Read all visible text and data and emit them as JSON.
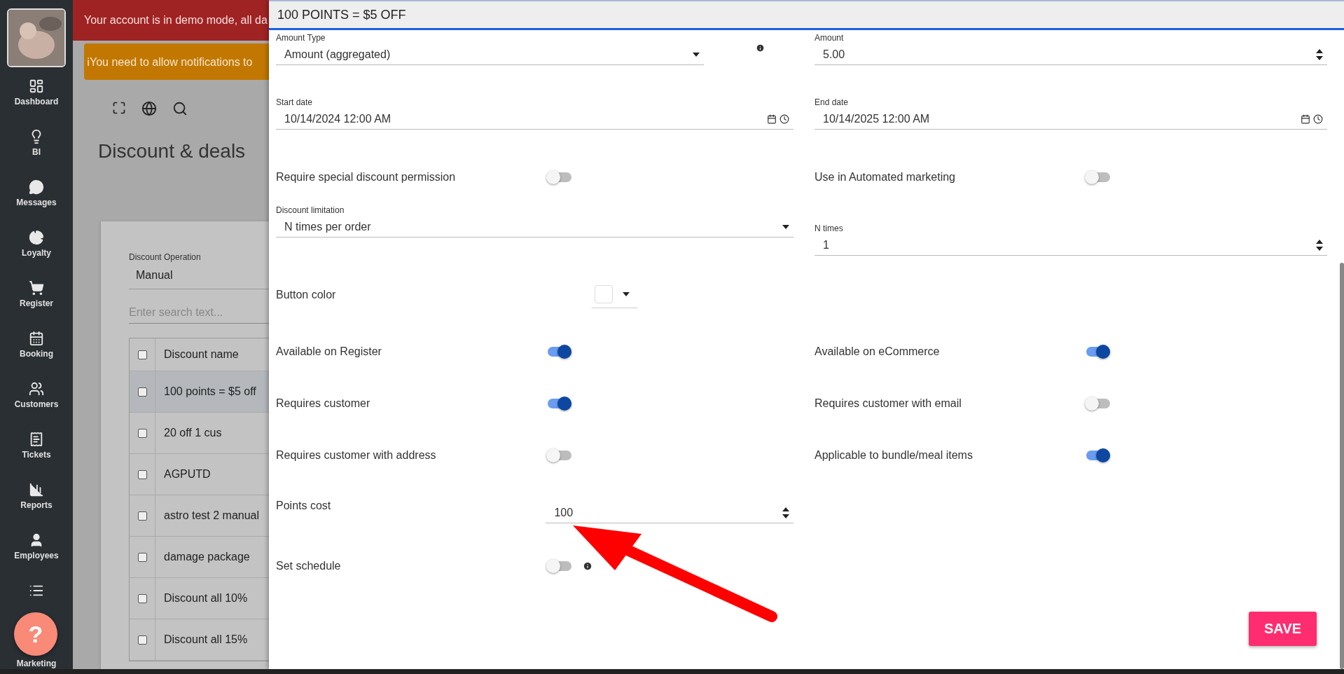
{
  "sidebar": {
    "items": [
      {
        "kind": "labeled",
        "label": "Dashboard"
      },
      {
        "kind": "labeled",
        "label": "BI"
      },
      {
        "kind": "labeled",
        "label": "Messages"
      },
      {
        "kind": "labeled",
        "label": "Loyalty"
      },
      {
        "kind": "labeled",
        "label": "Register"
      },
      {
        "kind": "labeled",
        "label": "Booking"
      },
      {
        "kind": "labeled",
        "label": "Customers"
      },
      {
        "kind": "labeled",
        "label": "Tickets"
      },
      {
        "kind": "labeled",
        "label": "Reports"
      },
      {
        "kind": "labeled",
        "label": "Employees"
      },
      {
        "kind": "icon-only"
      }
    ],
    "help": "?",
    "bottom_label": "Marketing"
  },
  "background": {
    "demo_banner": "Your account is in demo mode, all da",
    "notification_banner": {
      "icon": "ℹ",
      "text": "You need to allow notifications to"
    },
    "title": "Discount & deals",
    "operation": {
      "label": "Discount Operation",
      "value": "Manual"
    },
    "search": {
      "placeholder": "Enter search text..."
    },
    "table": {
      "header": "Discount name",
      "all_checked": false,
      "rows": [
        {
          "name": "100 points = $5 off",
          "selected": true,
          "checked": false
        },
        {
          "name": "20 off 1 cus",
          "selected": false,
          "checked": false
        },
        {
          "name": "AGPUTD",
          "selected": false,
          "checked": false
        },
        {
          "name": "astro test 2 manual",
          "selected": false,
          "checked": false
        },
        {
          "name": "damage package",
          "selected": false,
          "checked": false
        },
        {
          "name": "Discount all 10%",
          "selected": false,
          "checked": false
        },
        {
          "name": "Discount all 15%",
          "selected": false,
          "checked": false
        }
      ]
    }
  },
  "panel": {
    "title": "100 POINTS = $5 OFF",
    "rows": [
      {
        "left": {
          "kind": "select",
          "label": "Amount Type",
          "value": "Amount (aggregated)",
          "info": true
        },
        "right": {
          "kind": "number",
          "label": "Amount",
          "value": "5.00"
        }
      },
      {
        "left": {
          "kind": "date",
          "label": "Start date",
          "value": "10/14/2024 12:00 AM"
        },
        "right": {
          "kind": "date",
          "label": "End date",
          "value": "10/14/2025 12:00 AM"
        }
      },
      {
        "left": {
          "kind": "toggle",
          "label": "Require special discount permission",
          "on": false
        },
        "right": {
          "kind": "toggle",
          "label": "Use in Automated marketing",
          "on": false
        }
      },
      {
        "left": {
          "kind": "select",
          "label": "Discount limitation",
          "value": "N times per order"
        },
        "right": {
          "kind": "number",
          "label": "N times",
          "value": "1"
        }
      },
      {
        "left": {
          "kind": "color",
          "label": "Button color",
          "color": "#ffffff"
        }
      },
      {
        "left": {
          "kind": "toggle",
          "label": "Available on Register",
          "on": true
        },
        "right": {
          "kind": "toggle",
          "label": "Available on eCommerce",
          "on": true
        }
      },
      {
        "left": {
          "kind": "toggle",
          "label": "Requires customer",
          "on": true
        },
        "right": {
          "kind": "toggle",
          "label": "Requires customer with email",
          "on": false
        }
      },
      {
        "left": {
          "kind": "toggle",
          "label": "Requires customer with address",
          "on": false
        },
        "right": {
          "kind": "toggle",
          "label": "Applicable to bundle/meal items",
          "on": true
        }
      },
      {
        "left": {
          "kind": "inline-number",
          "label": "Points cost",
          "value": "100"
        }
      },
      {
        "left": {
          "kind": "toggle",
          "label": "Set schedule",
          "on": false,
          "info": true
        }
      }
    ],
    "save": "SAVE"
  }
}
